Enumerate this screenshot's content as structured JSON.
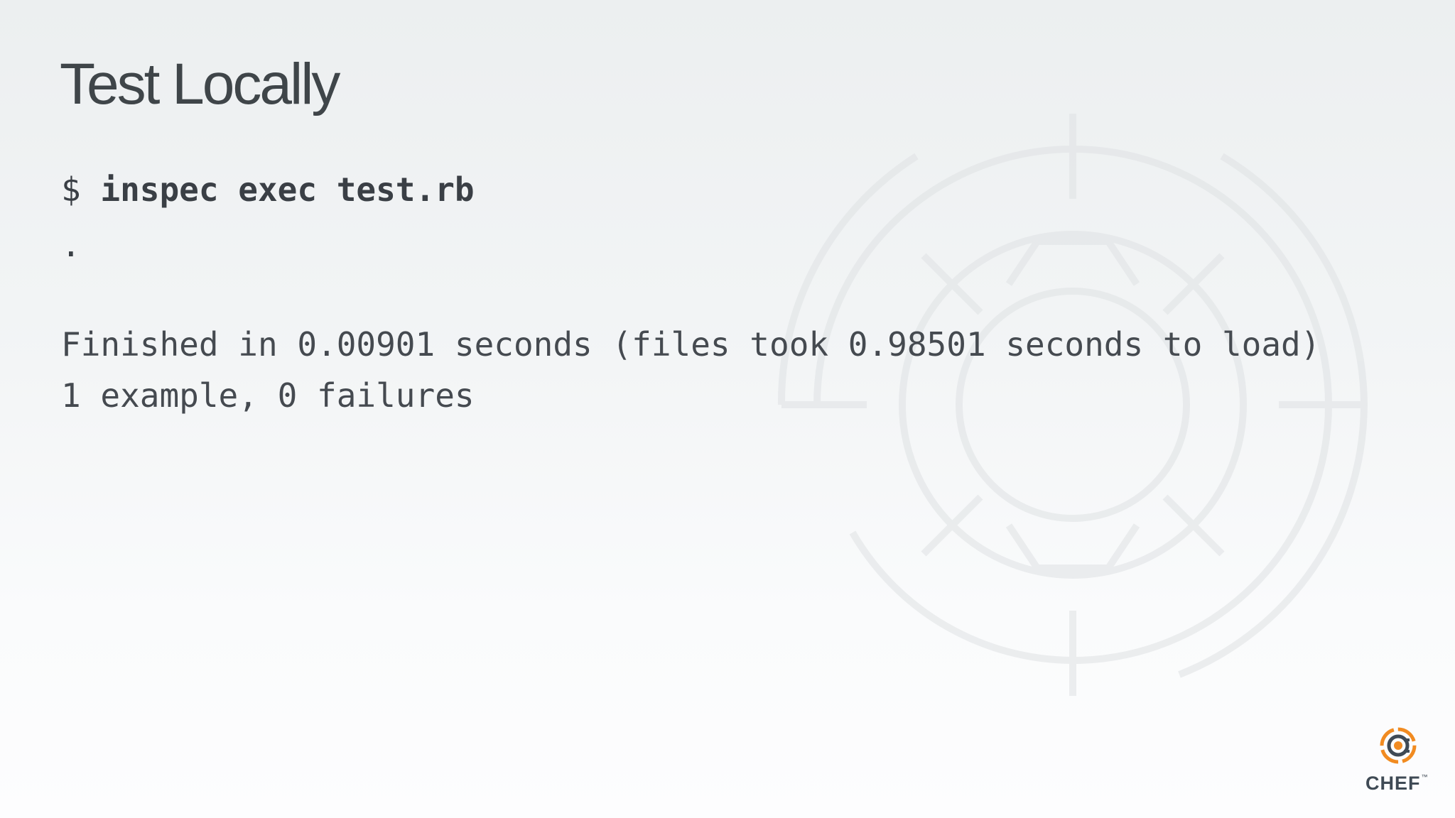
{
  "slide": {
    "title": "Test Locally"
  },
  "terminal": {
    "prompt": "$ ",
    "command": "inspec exec test.rb",
    "progress": ".",
    "result": "Finished in 0.00901 seconds (files took 0.98501 seconds to load)",
    "summary": "1 example, 0 failures"
  },
  "logo": {
    "text": "CHEF",
    "trademark": "™",
    "icon": "chef-logo-icon"
  },
  "colors": {
    "title": "#3f4549",
    "text": "#3a3f45",
    "logo_orange": "#f18b21",
    "logo_dark": "#3f4a55"
  }
}
